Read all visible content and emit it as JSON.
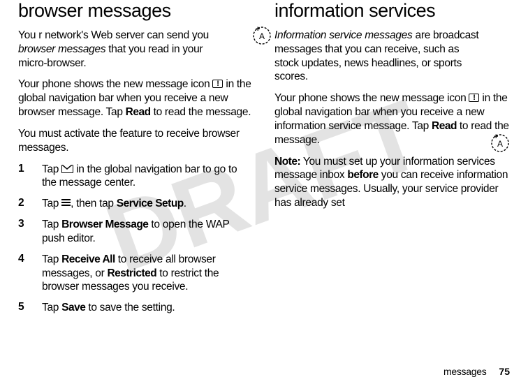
{
  "watermark": "DRAFT",
  "left": {
    "heading": "browser messages",
    "p1a": "You r network's Web server can send you ",
    "p1b": "browser messages",
    "p1c": " that you read in your micro-browser.",
    "p2a": "Your phone shows the new message icon ",
    "p2b": " in the global navigation bar when you receive a new browser message. Tap ",
    "p2c": "Read",
    "p2d": " to read the message.",
    "p3": "You must activate the feature to receive browser messages.",
    "s1a": "Tap ",
    "s1b": " in the global navigation bar to go to the message center.",
    "s2a": "Tap ",
    "s2b": ", then tap ",
    "s2c": "Service Setup",
    "s2d": ".",
    "s3a": "Tap ",
    "s3b": "Browser Message",
    "s3c": " to open the WAP push editor."
  },
  "right": {
    "s4a": "Tap ",
    "s4b": "Receive All",
    "s4c": " to receive all browser messages, or ",
    "s4d": "Restricted",
    "s4e": " to restrict the browser messages you receive.",
    "s5a": "Tap ",
    "s5b": "Save",
    "s5c": " to save the setting.",
    "heading": "information services",
    "p1a": "Information service messages",
    "p1b": " are broadcast messages that you can receive, such as stock updates, news headlines, or sports scores.",
    "p2a": "Your phone shows the new message icon ",
    "p2b": " in the global navigation bar when you receive a new information service message. Tap ",
    "p2c": "Read",
    "p2d": " to read the message.",
    "p3a": "Note:",
    "p3b": " You must set up your information services message inbox ",
    "p3c": "before",
    "p3d": " you can receive information service messages. Usually, your service provider has already set"
  },
  "footer": {
    "label": "messages",
    "num": "75"
  },
  "nums": {
    "n1": "1",
    "n2": "2",
    "n3": "3",
    "n4": "4",
    "n5": "5"
  }
}
